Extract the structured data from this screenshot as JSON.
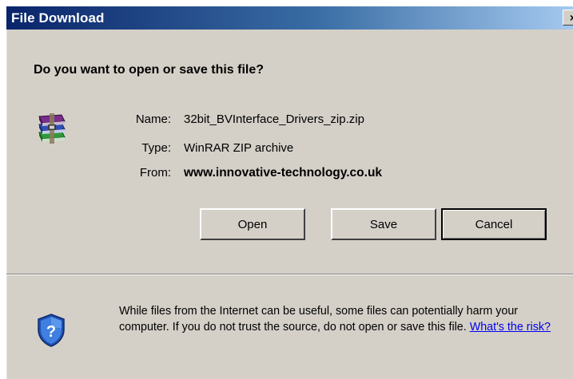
{
  "window": {
    "title": "File Download",
    "close_glyph": "×"
  },
  "prompt": {
    "question": "Do you want to open or save this file?"
  },
  "file": {
    "icon": "winrar-archive-icon",
    "name_label": "Name:",
    "name_value": "32bit_BVInterface_Drivers_zip.zip",
    "type_label": "Type:",
    "type_value": "WinRAR ZIP archive",
    "from_label": "From:",
    "from_value": "www.innovative-technology.co.uk"
  },
  "buttons": {
    "open": "Open",
    "save": "Save",
    "cancel": "Cancel"
  },
  "warning": {
    "icon": "security-shield-icon",
    "text": "While files from the Internet can be useful, some files can potentially harm your computer. If you do not trust the source, do not open or save this file.",
    "link": "What's the risk?"
  },
  "colors": {
    "titlebar_start": "#0a246a",
    "titlebar_end": "#a6caf0",
    "dialog_bg": "#d4d0c8",
    "link": "#0000ee"
  }
}
